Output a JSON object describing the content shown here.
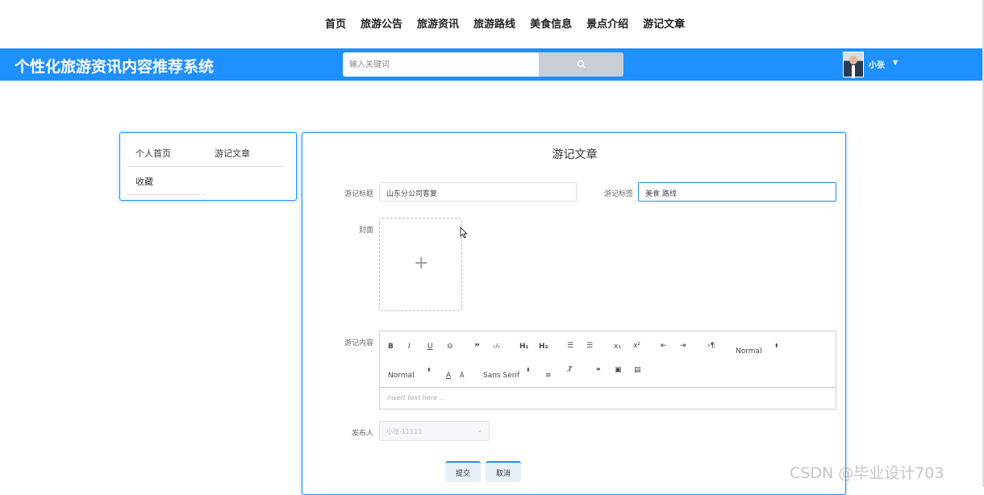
{
  "topnav": {
    "items": [
      "首页",
      "旅游公告",
      "旅游资讯",
      "旅游路线",
      "美食信息",
      "景点介绍",
      "游记文章"
    ]
  },
  "header": {
    "site_title": "个性化旅游资讯内容推荐系统",
    "search_placeholder": "输入关键词",
    "username": "小张",
    "colors": {
      "header_bg": "#1e90ff",
      "search_button": "#c9ced6"
    }
  },
  "sidebar": {
    "items": [
      "个人首页",
      "游记文章",
      "收藏"
    ]
  },
  "form": {
    "title": "游记文章",
    "title_label": "游记标题",
    "title_value": "山东分公司客复",
    "tags_label": "游记标签",
    "tags_value": "美食 路线",
    "cover_label": "封面",
    "content_label": "游记内容",
    "content_placeholder": "insert text here ...",
    "publisher_label": "发布人",
    "publisher_value": "小张-11111",
    "submit_label": "提交",
    "cancel_label": "取消"
  },
  "editor_toolbar": {
    "header_select": "Normal",
    "size_select": "Normal",
    "font_select": "Sans Serif"
  },
  "watermark": "CSDN @毕业设计703"
}
